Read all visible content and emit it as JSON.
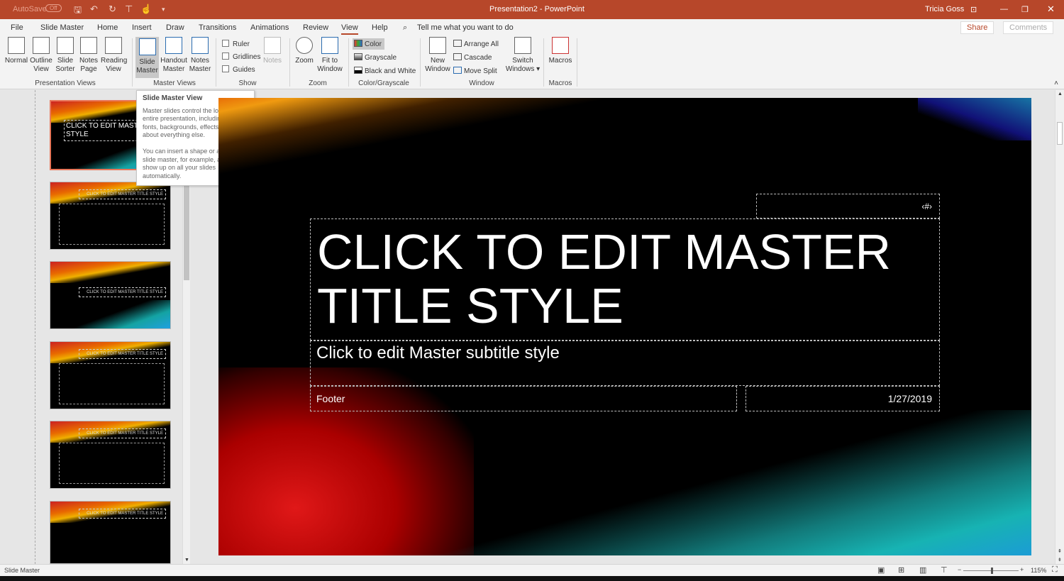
{
  "titlebar": {
    "autosave": "AutoSave",
    "autosave_state": "Off",
    "doc_title": "Presentation2  -  PowerPoint",
    "user": "Tricia Goss"
  },
  "tabs": [
    "File",
    "Slide Master",
    "Home",
    "Insert",
    "Draw",
    "Transitions",
    "Animations",
    "Review",
    "View",
    "Help"
  ],
  "active_tab": "View",
  "search": {
    "placeholder": "Tell me what you want to do"
  },
  "share_label": "Share",
  "comments_label": "Comments",
  "ribbon": {
    "presentation_views": {
      "label": "Presentation Views",
      "buttons": [
        [
          "Normal",
          ""
        ],
        [
          "Outline",
          "View"
        ],
        [
          "Slide",
          "Sorter"
        ],
        [
          "Notes",
          "Page"
        ],
        [
          "Reading",
          "View"
        ]
      ]
    },
    "master_views": {
      "label": "Master Views",
      "buttons": [
        [
          "Slide",
          "Master"
        ],
        [
          "Handout",
          "Master"
        ],
        [
          "Notes",
          "Master"
        ]
      ]
    },
    "show": {
      "label": "Show",
      "checkboxes": [
        "Ruler",
        "Gridlines",
        "Guides"
      ],
      "notes": "Notes"
    },
    "zoom": {
      "label": "Zoom",
      "buttons": [
        [
          "Zoom",
          ""
        ],
        [
          "Fit to",
          "Window"
        ]
      ]
    },
    "color": {
      "label": "Color/Grayscale",
      "items": [
        "Color",
        "Grayscale",
        "Black and White"
      ]
    },
    "window": {
      "label": "Window",
      "new": [
        "New",
        "Window"
      ],
      "items": [
        "Arrange All",
        "Cascade",
        "Move Split"
      ],
      "switch": [
        "Switch",
        "Windows ▾"
      ]
    },
    "macros": {
      "label": "Macros",
      "button": "Macros"
    }
  },
  "tooltip": {
    "title": "Slide Master View",
    "p1": "Master slides control the look of your entire presentation, including colors, fonts, backgrounds, effects, and just about everything else.",
    "p2": "You can insert a shape or a logo on a slide master, for example, and it will show up on all your slides automatically."
  },
  "thumbnails": {
    "first_title": "CLICK TO EDIT MASTER TITLE STYLE",
    "layout_title": "CLICK TO EDIT MASTER TITLE STYLE"
  },
  "slide": {
    "number": "‹#›",
    "title": "CLICK TO EDIT MASTER TITLE STYLE",
    "subtitle": "Click to edit Master subtitle style",
    "footer": "Footer",
    "date": "1/27/2019"
  },
  "status": {
    "mode": "Slide Master",
    "zoom": "115%",
    "zoom_level_percent": 115
  }
}
